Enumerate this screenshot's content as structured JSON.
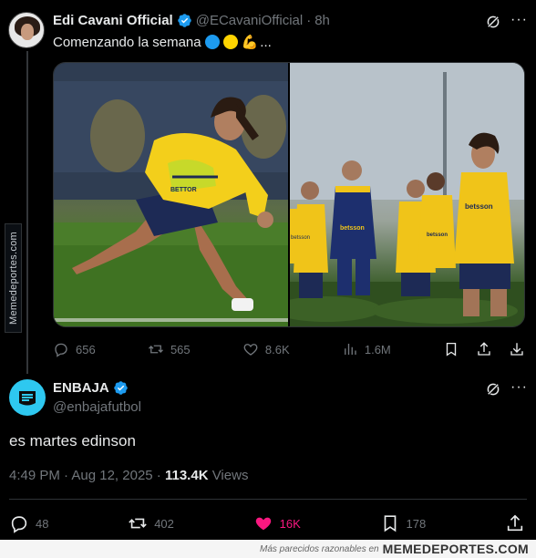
{
  "watermark_side": "Memedeportes.com",
  "tweet1": {
    "name": "Edi Cavani Official",
    "handle": "@ECavaniOfficial",
    "sep": "·",
    "time": "8h",
    "text": "Comenzando la semana",
    "emoji_colors": [
      "#1d9bf0",
      "#ffd400"
    ],
    "emoji_arm": "💪",
    "ellipsis": "...",
    "photo_left_sponsor": "BETTOR",
    "photo_right_sponsors": [
      "betsson",
      "betsson",
      "betsson",
      "betsson"
    ],
    "stats": {
      "replies": "656",
      "reposts": "565",
      "likes": "8.6K",
      "views": "1.6M"
    }
  },
  "tweet2": {
    "name": "ENBAJA",
    "handle": "@enbajafutbol",
    "text": "es martes edinson",
    "time": "4:49 PM",
    "sep": " · ",
    "date": "Aug 12, 2025",
    "sep2": " · ",
    "views_count": "113.4K",
    "views_label": "Views",
    "stats": {
      "replies": "48",
      "reposts": "402",
      "likes": "16K",
      "bookmarks": "178"
    }
  },
  "footer": {
    "tagline": "Más parecidos razonables en",
    "brand": "MEMEDEPORTES.COM"
  },
  "colors": {
    "verified": "#1d9bf0",
    "like_active": "#f91880",
    "muted": "#71767b",
    "text": "#e7e9ea"
  }
}
